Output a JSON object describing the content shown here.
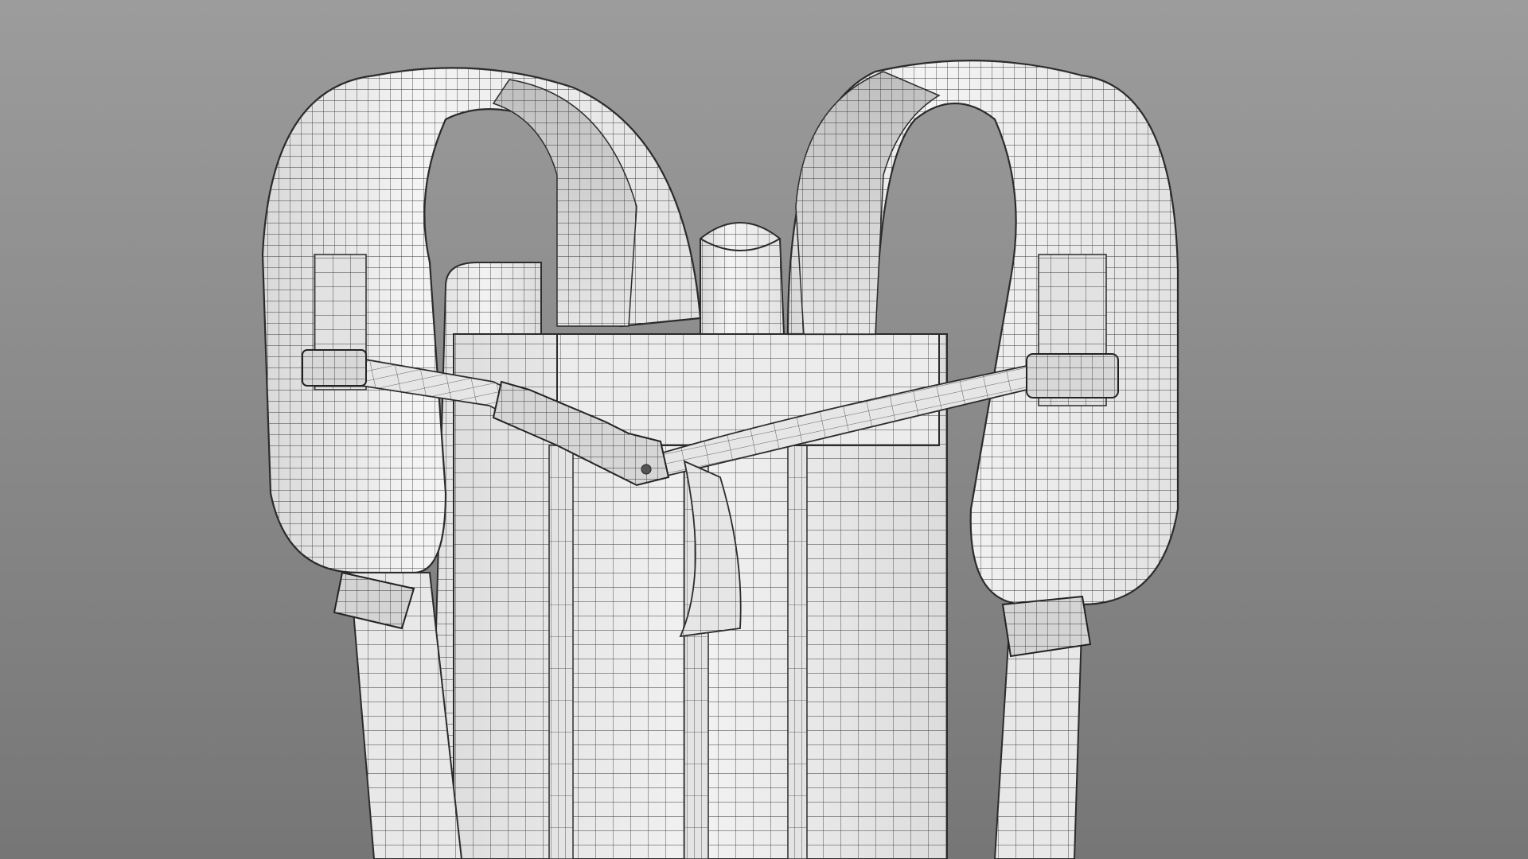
{
  "scene": {
    "subject": "backpack-wireframe-render",
    "background_top": "#9c9c9c",
    "background_bottom": "#767676",
    "surface_color": "#ececec",
    "shadow_color": "#cfcfcf",
    "wire_color": "#2b2b2b",
    "wire_light_color": "#6a6a6a"
  }
}
